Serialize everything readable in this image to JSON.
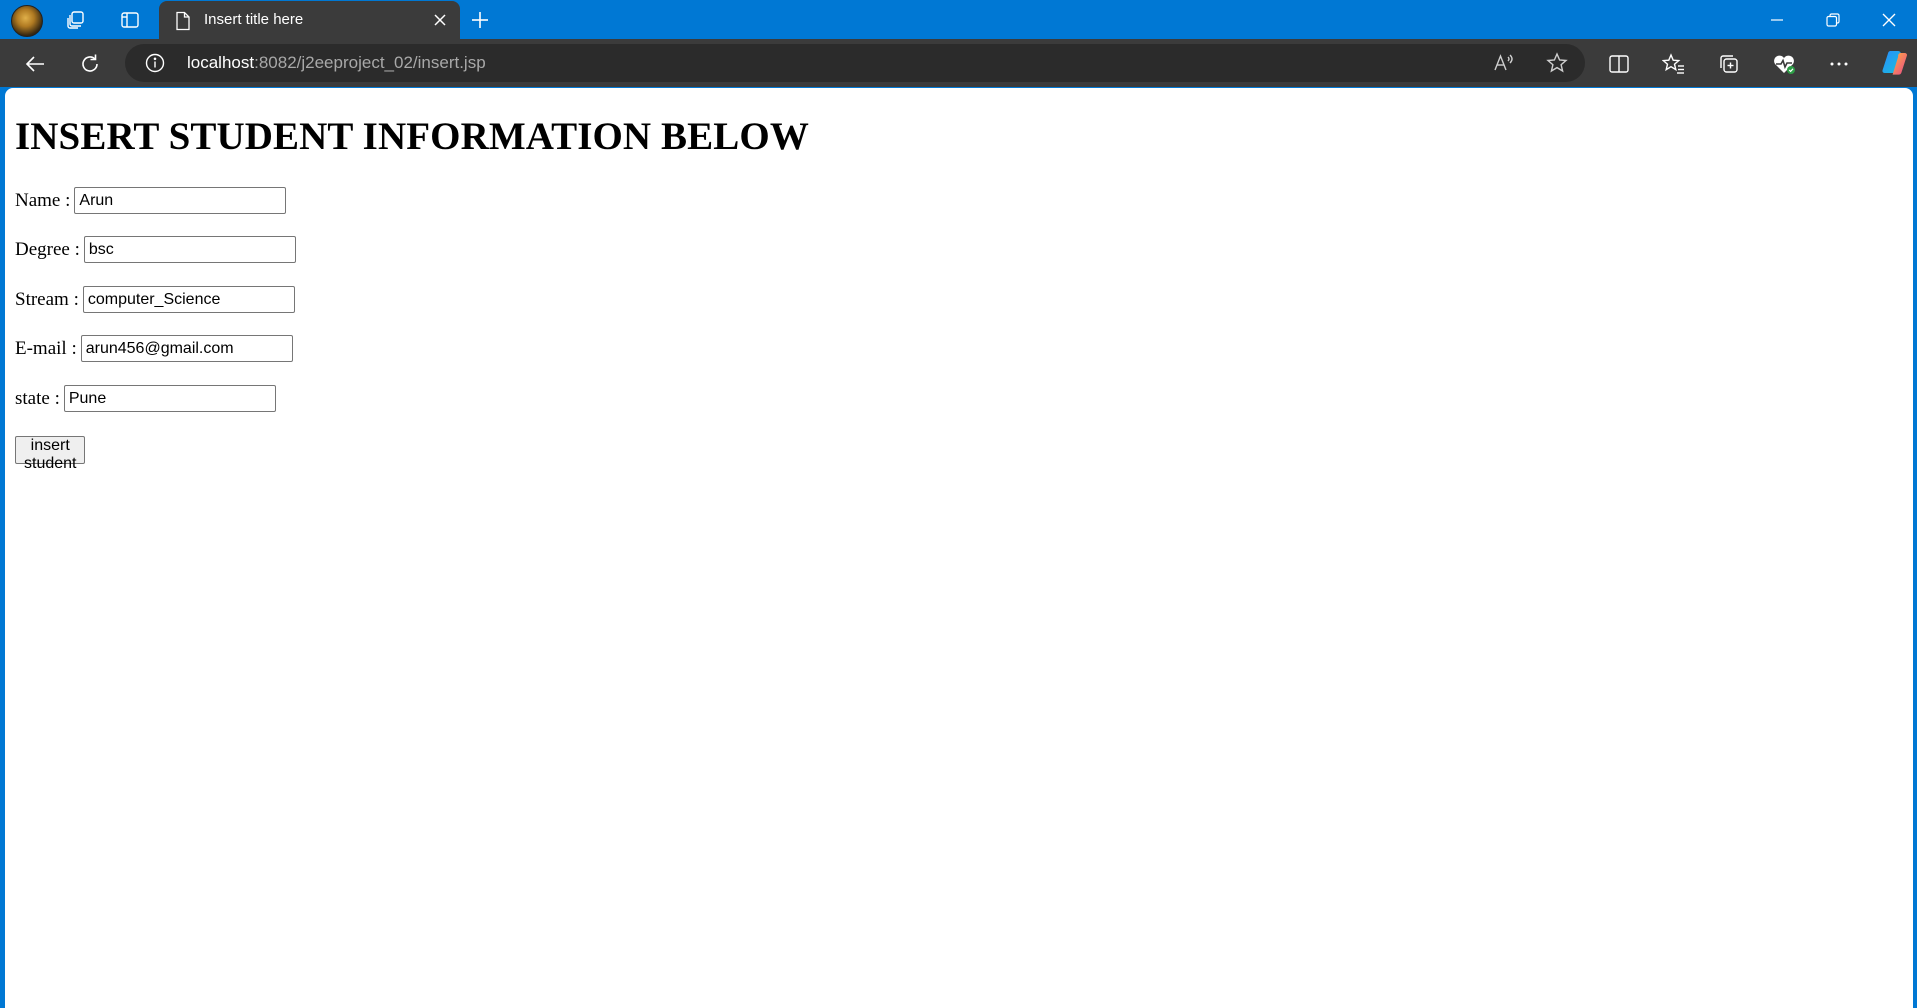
{
  "browser": {
    "tab": {
      "title": "Insert title here"
    },
    "address": {
      "host": "localhost",
      "rest": ":8082/j2eeproject_02/insert.jsp"
    },
    "accent_color": "#0078d4"
  },
  "page": {
    "heading": "INSERT STUDENT INFORMATION BELOW",
    "fields": [
      {
        "label": "Name :",
        "value": "Arun"
      },
      {
        "label": "Degree :",
        "value": "bsc"
      },
      {
        "label": "Stream :",
        "value": "computer_Science"
      },
      {
        "label": "E-mail :",
        "value": "arun456@gmail.com"
      },
      {
        "label": "state :",
        "value": "Pune"
      }
    ],
    "submit_label": "insert student"
  },
  "icons": {
    "titlebar": [
      "profile-avatar",
      "workspaces-icon",
      "vertical-tabs-icon",
      "page-icon",
      "close-icon",
      "plus-icon",
      "minimize-icon",
      "restore-icon",
      "window-close-icon"
    ],
    "toolbar": [
      "back-icon",
      "refresh-icon",
      "info-icon",
      "read-aloud-icon",
      "star-icon",
      "split-screen-icon",
      "favorites-icon",
      "collections-icon",
      "browser-essentials-icon",
      "more-icon",
      "copilot-icon"
    ]
  }
}
